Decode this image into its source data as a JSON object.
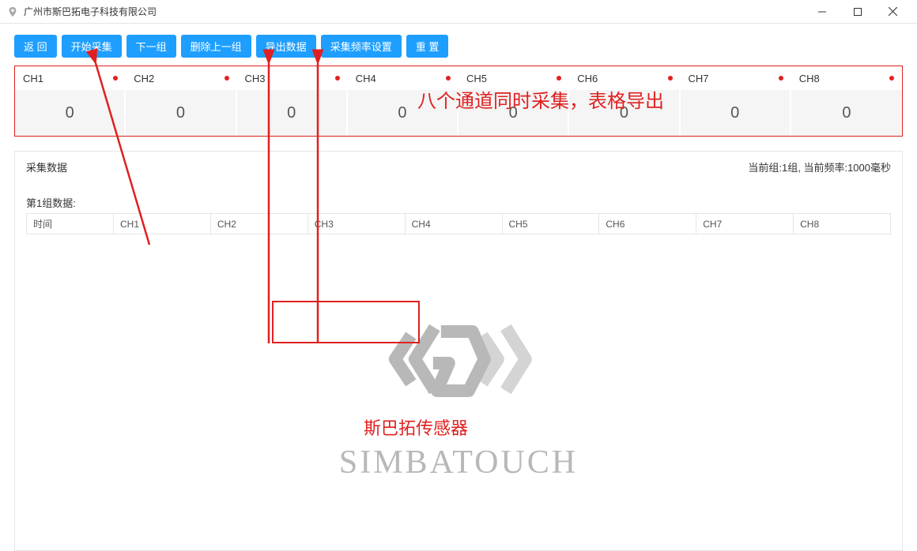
{
  "window": {
    "title": "广州市斯巴拓电子科技有限公司"
  },
  "toolbar": {
    "back": "返 回",
    "start": "开始采集",
    "next": "下一组",
    "delete_prev": "删除上一组",
    "export": "导出数据",
    "freq": "采集频率设置",
    "reset": "重 置"
  },
  "channels": [
    {
      "label": "CH1",
      "value": "0"
    },
    {
      "label": "CH2",
      "value": "0"
    },
    {
      "label": "CH3",
      "value": "0"
    },
    {
      "label": "CH4",
      "value": "0"
    },
    {
      "label": "CH5",
      "value": "0"
    },
    {
      "label": "CH6",
      "value": "0"
    },
    {
      "label": "CH7",
      "value": "0"
    },
    {
      "label": "CH8",
      "value": "0"
    }
  ],
  "panel": {
    "title": "采集数据",
    "status": "当前组:1组, 当前频率:1000毫秒",
    "group_title": "第1组数据:",
    "columns": [
      "时间",
      "CH1",
      "CH2",
      "CH3",
      "CH4",
      "CH5",
      "CH6",
      "CH7",
      "CH8"
    ]
  },
  "watermark": {
    "brand": "SIMBATOUCH"
  },
  "annotation": {
    "line1": "八个通道同时采集，表格导出",
    "line2": "斯巴拓传感器"
  }
}
